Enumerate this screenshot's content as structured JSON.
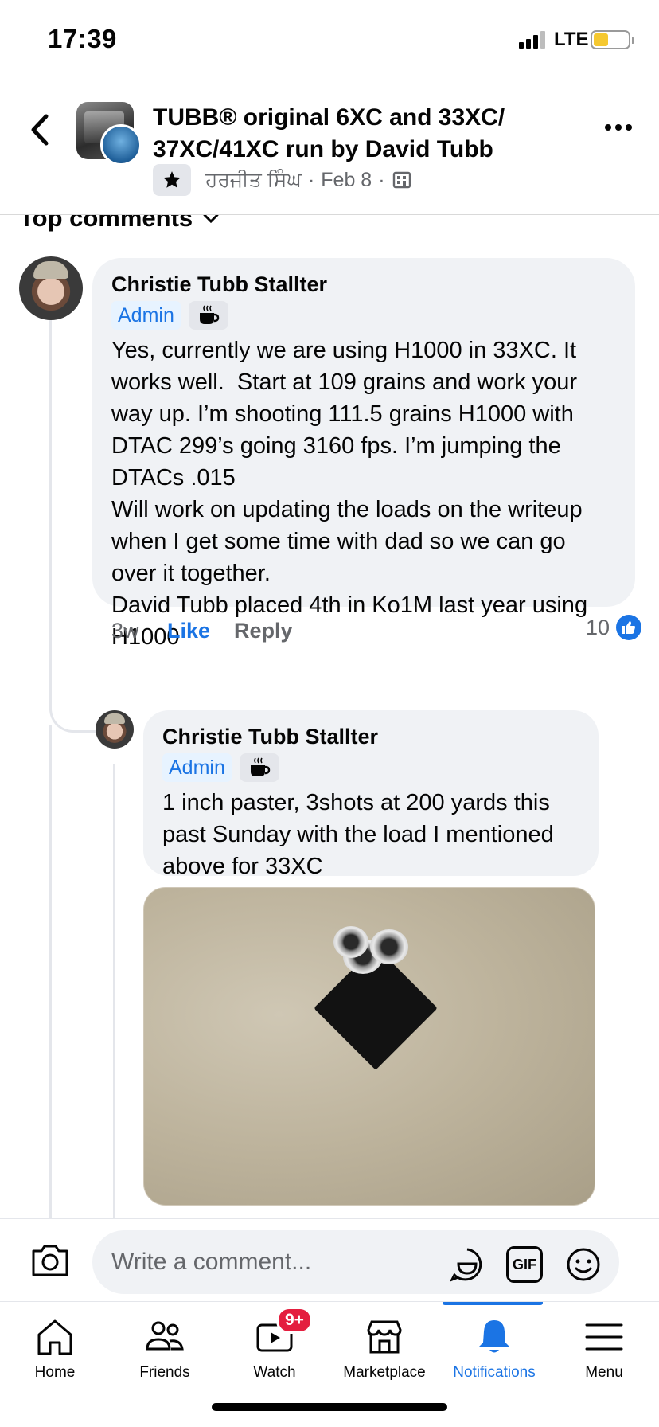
{
  "status_bar": {
    "time": "17:39",
    "network": "LTE"
  },
  "header": {
    "title": "TUBB® original 6XC and 33XC/ 37XC/41XC run by David Tubb",
    "author": "ਹਰਜੀਤ ਸਿੰਘ",
    "dot1": "·",
    "date": "Feb 8",
    "dot2": "·"
  },
  "sort": {
    "label": "Top comments"
  },
  "comments": [
    {
      "author": "Christie Tubb Stallter",
      "badge": "Admin",
      "text": "Yes, currently we are using H1000 in 33XC. It works well.  Start at 109 grains and work your way up. I’m shooting 111.5 grains H1000 with DTAC 299’s going 3160 fps. I’m jumping the DTACs .015\nWill work on updating the loads on the writeup when I get some time with dad so we can go over it together.\nDavid Tubb placed 4th in Ko1M last year using H1000",
      "time": "3w",
      "like_label": "Like",
      "reply_label": "Reply",
      "reactions": "10"
    },
    {
      "author": "Christie Tubb Stallter",
      "badge": "Admin",
      "text": "1 inch paster, 3shots at 200 yards this past Sunday with the load I mentioned above for 33XC"
    }
  ],
  "composer": {
    "placeholder": "Write a comment...",
    "gif_label": "GIF"
  },
  "tabbar": {
    "items": [
      {
        "label": "Home",
        "icon": "home-icon"
      },
      {
        "label": "Friends",
        "icon": "friends-icon"
      },
      {
        "label": "Watch",
        "icon": "watch-icon",
        "badge": "9+"
      },
      {
        "label": "Marketplace",
        "icon": "marketplace-icon"
      },
      {
        "label": "Notifications",
        "icon": "bell-icon",
        "active": true
      },
      {
        "label": "Menu",
        "icon": "menu-icon"
      }
    ]
  },
  "colors": {
    "accent": "#1b74e4",
    "bubble": "#f0f2f5",
    "badge_red": "#e41e3f",
    "secondary_text": "#65676b"
  }
}
